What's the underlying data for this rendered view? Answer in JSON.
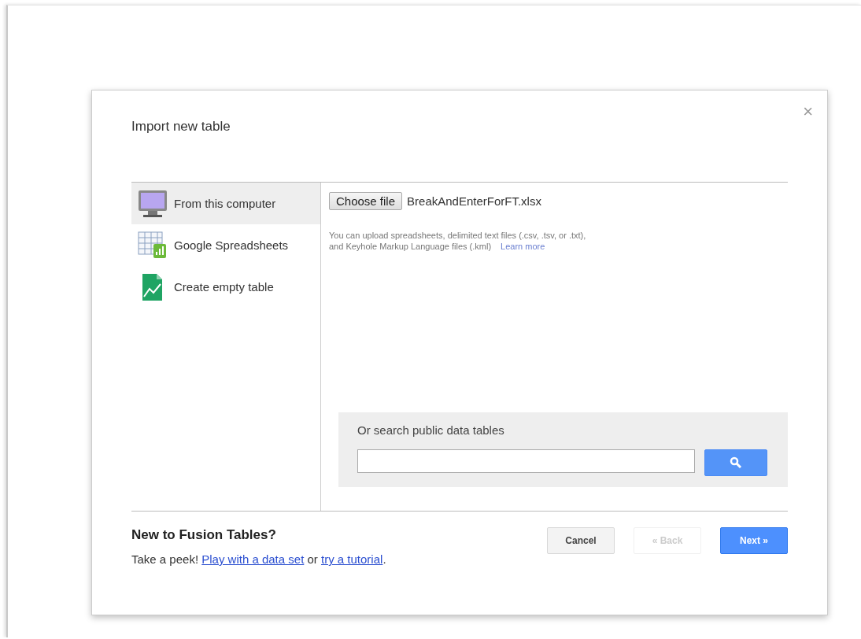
{
  "dialog": {
    "title": "Import new table",
    "close": "×"
  },
  "sources": [
    {
      "kind": "computer",
      "label": "From this computer",
      "selected": true
    },
    {
      "kind": "spreadsheet",
      "label": "Google Spreadsheets",
      "selected": false
    },
    {
      "kind": "empty",
      "label": "Create empty table",
      "selected": false
    }
  ],
  "upload": {
    "button": "Choose file",
    "file_name": "BreakAndEnterForFT.xlsx",
    "help": "You can upload spreadsheets, delimited text files (.csv, .tsv, or .txt),",
    "help_2": "and Keyhole Markup Language files (.kml)",
    "learn_more": "Learn more"
  },
  "search": {
    "label": "Or search public data tables"
  },
  "footer": {
    "heading": "New to Fusion Tables?",
    "intro": "Take a peek!",
    "link_1": "Play with a data set",
    "joiner": "or",
    "link_2": "try a tutorial",
    "end": "."
  },
  "buttons": [
    {
      "label": "Cancel",
      "kind": "plain",
      "disabled": false
    },
    {
      "label": "« Back",
      "kind": "plain",
      "disabled": true
    },
    {
      "label": "Next »",
      "kind": "primary",
      "disabled": false
    }
  ]
}
